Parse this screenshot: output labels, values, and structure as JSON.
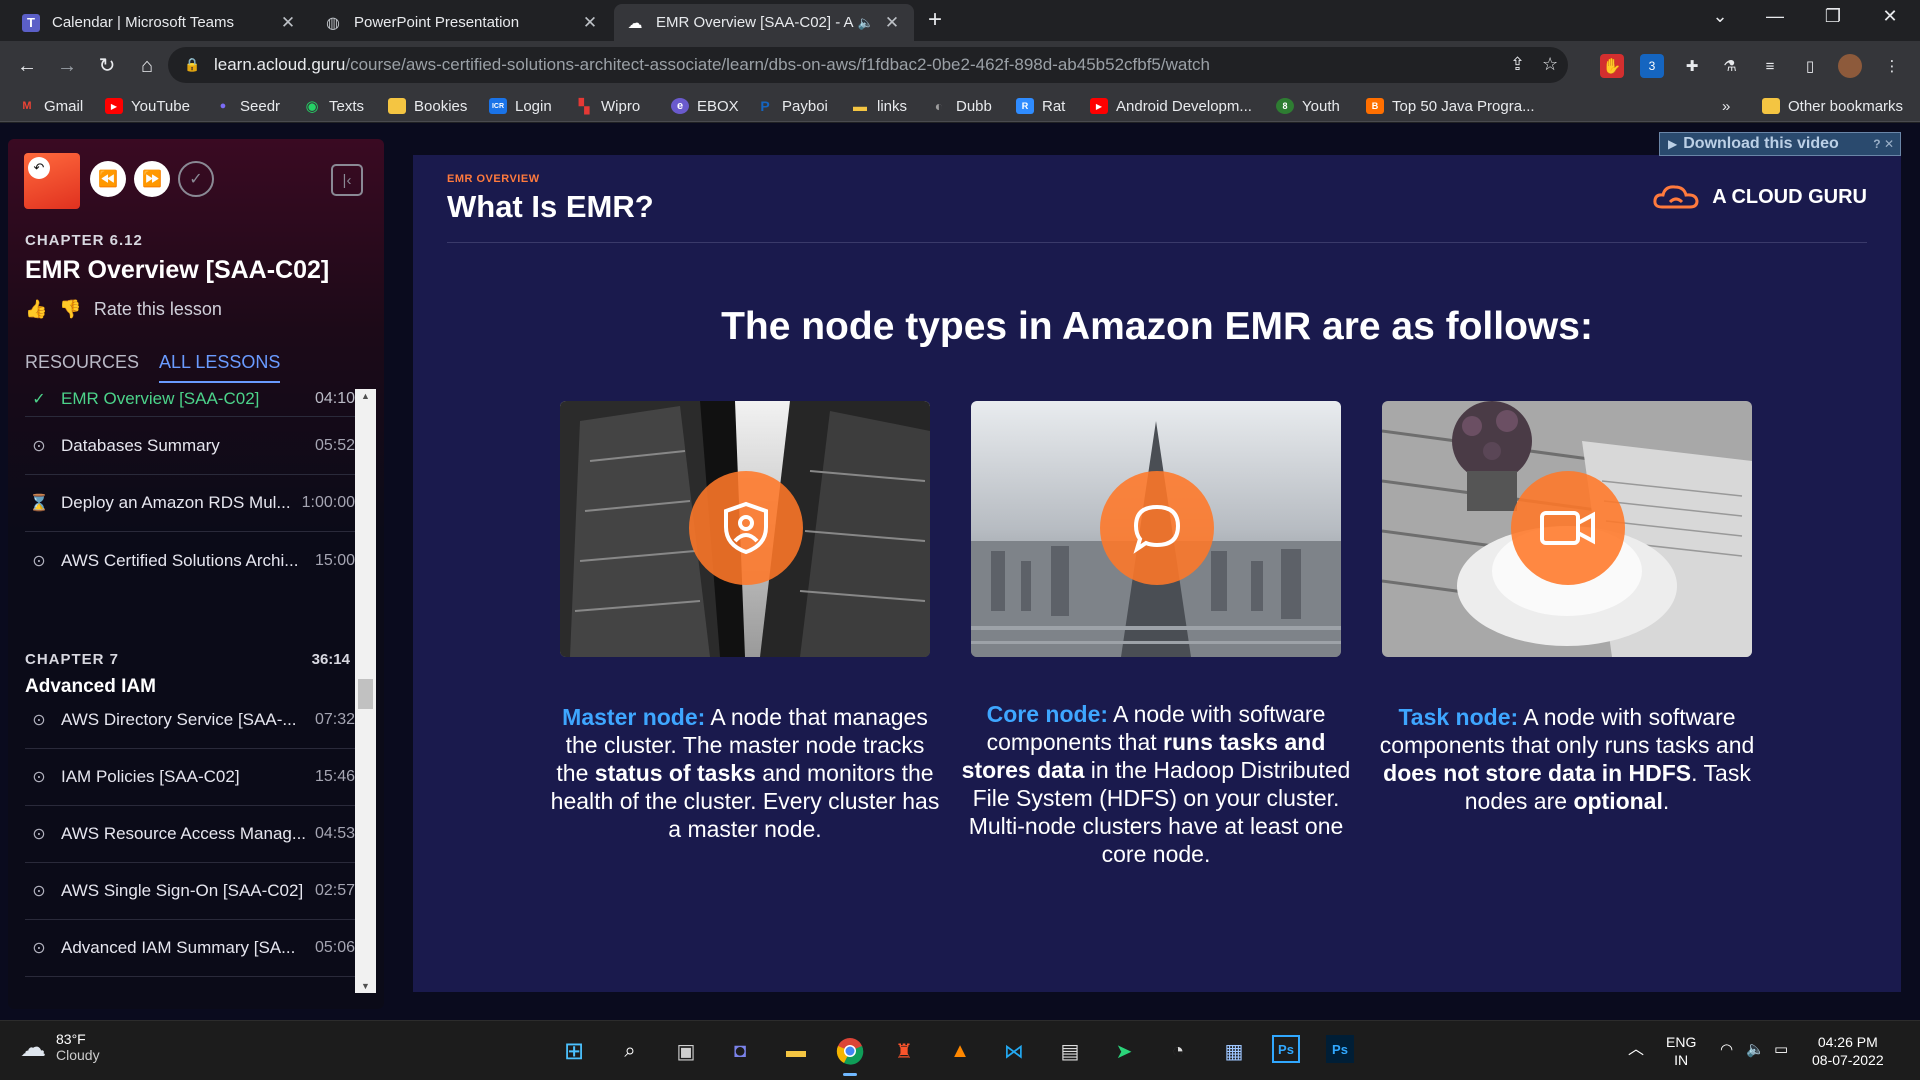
{
  "browser": {
    "tabs": [
      {
        "title": "Calendar | Microsoft Teams",
        "icon": "teams-icon"
      },
      {
        "title": "PowerPoint Presentation",
        "icon": "globe-icon"
      },
      {
        "title": "EMR Overview [SAA-C02] - A",
        "icon": "acloudguru-icon",
        "active": true
      }
    ],
    "url_host": "learn.acloud.guru",
    "url_path": "/course/aws-certified-solutions-architect-associate/learn/dbs-on-aws/f1fdbac2-0be2-462f-898d-ab45b52cfbf5/watch",
    "extension_badge": "3",
    "bookmarks": [
      {
        "label": "Gmail",
        "color": "#ea4335"
      },
      {
        "label": "YouTube",
        "color": "#ff0000"
      },
      {
        "label": "Seedr",
        "color": "#7b6cf6"
      },
      {
        "label": "Texts",
        "color": "#25d366"
      },
      {
        "label": "Bookies",
        "color": "#f4c542"
      },
      {
        "label": "Login",
        "color": "#1a73e8"
      },
      {
        "label": "Wipro",
        "color": "#e53935"
      },
      {
        "label": "EBOX",
        "color": "#6a5acd"
      },
      {
        "label": "Payboi",
        "color": "#1565c0"
      },
      {
        "label": "links",
        "color": "#f4c542"
      },
      {
        "label": "Dubb",
        "color": "#9e9e9e"
      },
      {
        "label": "Rat",
        "color": "#2f8cff"
      },
      {
        "label": "Android Developm...",
        "color": "#ff0000"
      },
      {
        "label": "Youth",
        "color": "#2e7d32"
      },
      {
        "label": "Top 50 Java Progra...",
        "color": "#ff6f00"
      }
    ],
    "overflow": "»",
    "other_bookmarks": "Other bookmarks"
  },
  "sidebar": {
    "chapter_label": "CHAPTER 6.12",
    "lesson_title": "EMR Overview [SAA-C02]",
    "rate_label": "Rate this lesson",
    "tabs": [
      "RESOURCES",
      "ALL LESSONS"
    ],
    "lessons_before": [
      {
        "title": "EMR Overview [SAA-C02]",
        "duration": "04:10",
        "icon": "check-icon",
        "current": true
      },
      {
        "title": "Databases Summary",
        "duration": "05:52",
        "icon": "play-circle-icon"
      },
      {
        "title": "Deploy an Amazon RDS Mul...",
        "duration": "1:00:00",
        "icon": "lab-flask-icon"
      },
      {
        "title": "AWS Certified Solutions Archi...",
        "duration": "15:00",
        "icon": "play-circle-icon"
      }
    ],
    "chapter7": {
      "label": "CHAPTER 7",
      "duration": "36:14",
      "name": "Advanced IAM"
    },
    "lessons_after": [
      {
        "title": "AWS Directory Service [SAA-...",
        "duration": "07:32",
        "icon": "play-circle-icon"
      },
      {
        "title": "IAM Policies [SAA-C02]",
        "duration": "15:46",
        "icon": "play-circle-icon"
      },
      {
        "title": "AWS Resource Access Manag...",
        "duration": "04:53",
        "icon": "play-circle-icon"
      },
      {
        "title": "AWS Single Sign-On [SAA-C02]",
        "duration": "02:57",
        "icon": "play-circle-icon"
      },
      {
        "title": "Advanced IAM Summary [SA...",
        "duration": "05:06",
        "icon": "play-circle-icon"
      }
    ]
  },
  "video": {
    "download_label": "Download this video",
    "kicker": "EMR OVERVIEW",
    "title": "What Is EMR?",
    "brand": "A CLOUD GURU",
    "heading": "The node types in Amazon EMR are as follows:",
    "cards": [
      {
        "key": "Master node:",
        "icon": "shield-user-icon"
      },
      {
        "key": "Core node:",
        "icon": "chat-bubble-icon"
      },
      {
        "key": "Task node:",
        "icon": "video-camera-icon"
      }
    ]
  },
  "taskbar": {
    "temp": "83°F",
    "condition": "Cloudy",
    "lang1": "ENG",
    "lang2": "IN",
    "time": "04:26 PM",
    "date": "08-07-2022"
  },
  "colors": {
    "accent_blue": "#3ea6ff",
    "accent_orange": "#ff7a3d",
    "lesson_green": "#4cd38a",
    "tab_blue": "#6a9bff"
  }
}
